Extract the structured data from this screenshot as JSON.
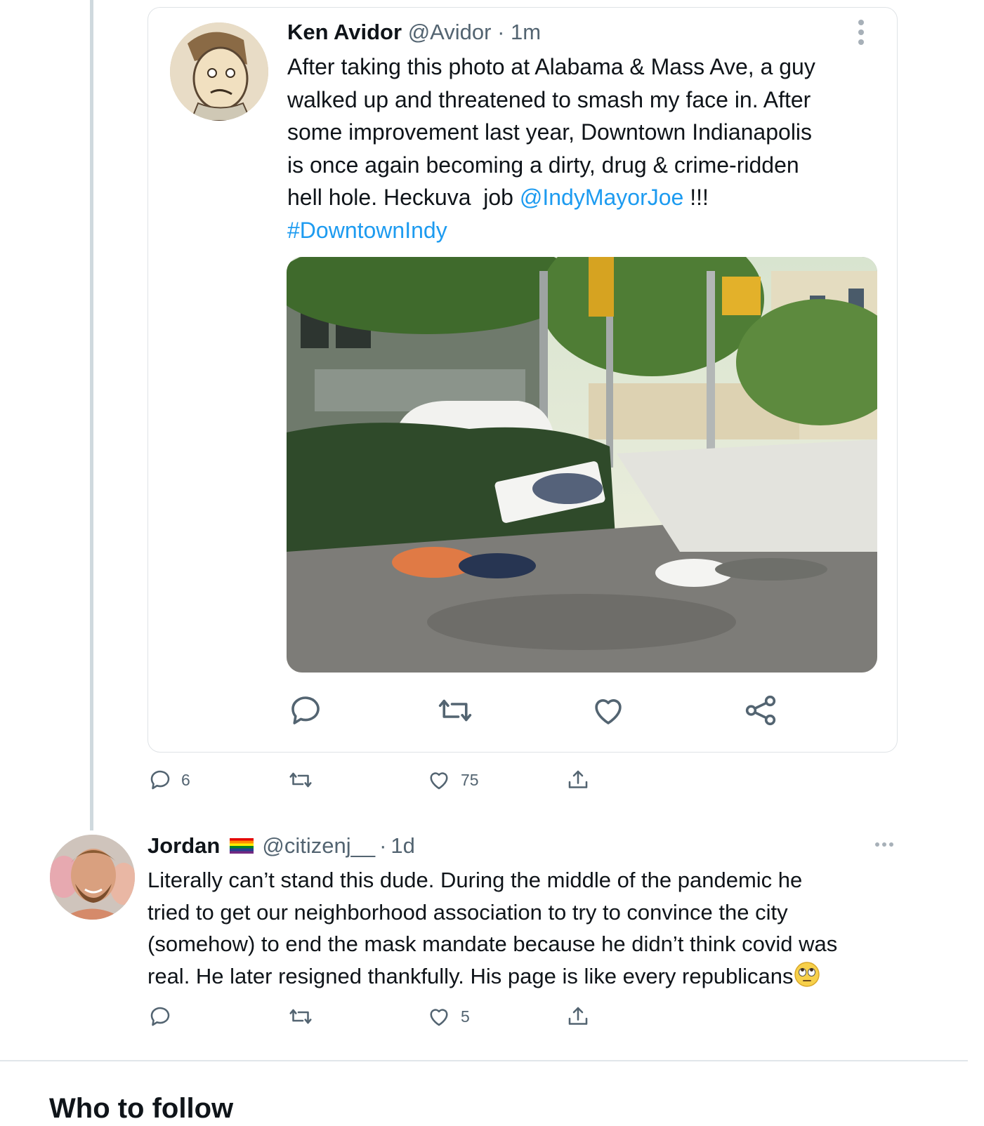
{
  "quoted_tweet": {
    "author_name": "Ken Avidor",
    "handle": "@Avidor",
    "separator": "·",
    "time": "1m",
    "text_lines": [
      {
        "before": "After taking this photo at Alabama & Mass Ave, a guy",
        "link": "",
        "after": ""
      },
      {
        "before": "walked up and threatened to smash my face in. After",
        "link": "",
        "after": ""
      },
      {
        "before": "some improvement last year, Downtown Indianapolis",
        "link": "",
        "after": ""
      },
      {
        "before": "is once again becoming a dirty, drug & crime-ridden",
        "link": "",
        "after": ""
      },
      {
        "before": "hell hole. Heckuva  job ",
        "link": "@IndyMayorJoe",
        "after": " !!!"
      },
      {
        "before": "",
        "link": "#DowntownIndy",
        "after": ""
      }
    ]
  },
  "parent_actions": {
    "reply_count": "6",
    "retweet_count": "",
    "like_count": "75"
  },
  "reply_tweet": {
    "author_name": "Jordan",
    "flag_icon": "rainbow-flag-icon",
    "handle": "@citizenj__",
    "separator": "·",
    "time": "1d",
    "text_lines": [
      "Literally can’t stand this dude. During the middle of the pandemic he",
      "tried to get our neighborhood association to try to convince the city",
      "(somehow) to end the mask mandate because he didn’t think covid was",
      "real. He later resigned thankfully. His page is like every republicans"
    ],
    "emoji": "eye-roll-emoji",
    "actions": {
      "reply_count": "",
      "retweet_count": "",
      "like_count": "5"
    }
  },
  "next_section_title": "Who to follow",
  "colors": {
    "link": "#1d9bf0",
    "secondary_text": "#536471",
    "icon": "#536471",
    "border": "#dfe3e6"
  }
}
